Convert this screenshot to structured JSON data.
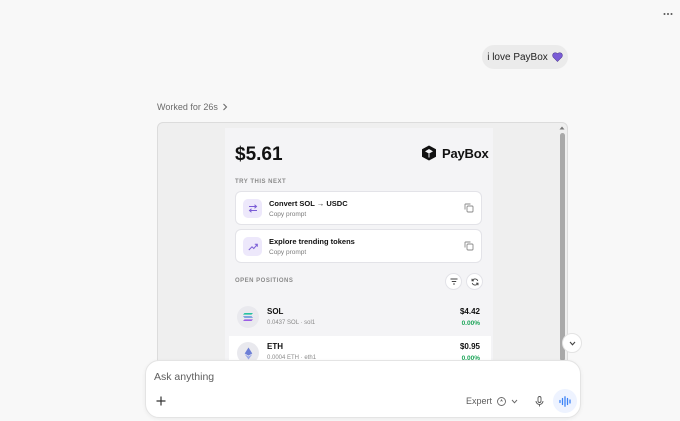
{
  "header": {
    "more_icon": "more-horizontal-icon"
  },
  "chat": {
    "user_message": "i love PayBox",
    "user_emoji": "purple-heart-icon",
    "worked_label": "Worked for 26s"
  },
  "app": {
    "balance": "$5.61",
    "brand": "PayBox",
    "try_next_label": "TRY THIS NEXT",
    "prompts": [
      {
        "title": "Convert SOL → USDC",
        "subtitle": "Copy prompt",
        "icon": "swap-arrows-icon"
      },
      {
        "title": "Explore trending tokens",
        "subtitle": "Copy prompt",
        "icon": "trending-up-icon"
      }
    ],
    "positions_label": "OPEN POSITIONS",
    "positions": [
      {
        "symbol": "SOL",
        "detail": "0.0437 SOL · sol1",
        "value": "$4.42",
        "change": "0.00%"
      },
      {
        "symbol": "ETH",
        "detail": "0.0004 ETH · eth1",
        "value": "$0.95",
        "change": "0.00%"
      }
    ]
  },
  "composer": {
    "placeholder": "Ask anything",
    "mode": "Expert"
  },
  "colors": {
    "accent_purple": "#7a5cd6",
    "positive_green": "#1ea65a",
    "voice_blue": "#3b82f6"
  }
}
